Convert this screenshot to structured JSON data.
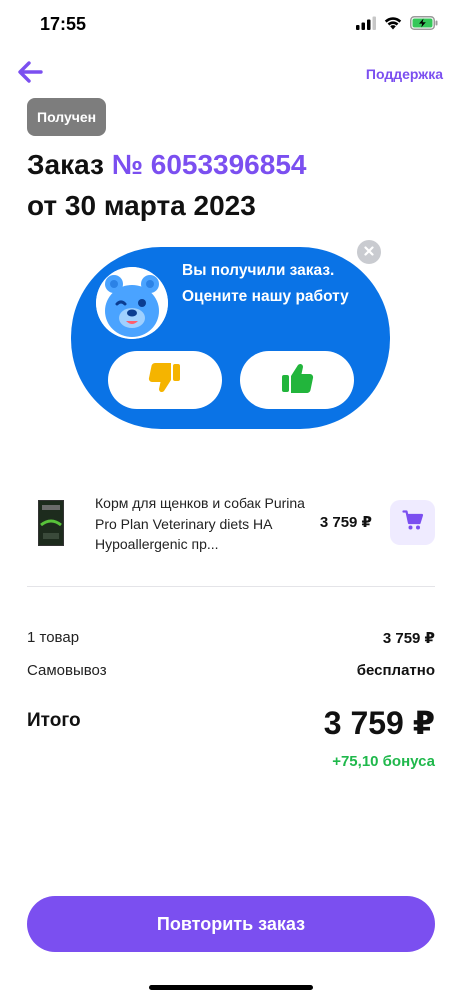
{
  "status_bar": {
    "time": "17:55",
    "icons": [
      "signal-icon",
      "wifi-icon",
      "battery-charging-icon"
    ]
  },
  "nav": {
    "back_icon": "arrow-left-icon",
    "support_label": "Поддержка"
  },
  "order": {
    "status_badge": "Получен",
    "title_prefix": "Заказ",
    "number": "№ 6053396854",
    "date": "от 30 марта 2023"
  },
  "rating_prompt": {
    "text": "Вы получили заказ. Оцените нашу работу",
    "mascot_icon": "bear-mascot-icon",
    "close_icon": "close-icon",
    "dislike_icon": "thumbs-down-icon",
    "like_icon": "thumbs-up-icon"
  },
  "product": {
    "name": "Корм для щенков и собак Purina Pro Plan Veterinary diets HA Hypoallergenic пр...",
    "price": "3 759 ₽",
    "cart_icon": "cart-icon"
  },
  "summary": {
    "items_label": "1 товар",
    "items_value": "3 759 ₽",
    "delivery_label": "Самовывоз",
    "delivery_value": "бесплатно",
    "total_label": "Итого",
    "total_value": "3 759 ₽",
    "bonus": "+75,10 бонуса"
  },
  "actions": {
    "repeat_label": "Повторить заказ"
  },
  "colors": {
    "accent": "#7b4ff0",
    "card_blue": "#0a73e6",
    "bonus_green": "#1fb84b",
    "badge_gray": "#7d7d7d",
    "dislike_yellow": "#f5b400",
    "like_green": "#22b53c"
  }
}
